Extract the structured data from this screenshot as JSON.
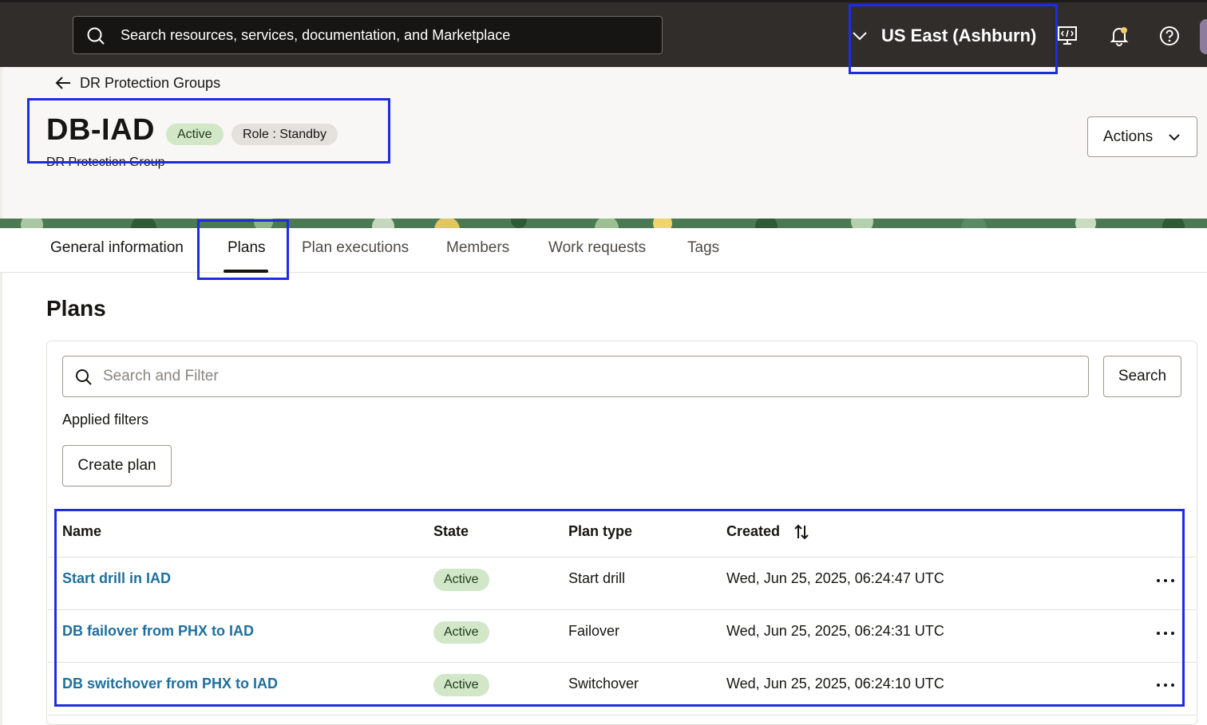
{
  "topbar": {
    "search_placeholder": "Search resources, services, documentation, and Marketplace",
    "region": "US East (Ashburn)",
    "icons": [
      "search-icon",
      "chevron-down-icon",
      "cloud-shell-icon",
      "bell-icon",
      "help-icon"
    ]
  },
  "header": {
    "breadcrumb": "DR Protection Groups",
    "title": "DB-IAD",
    "status_badge": "Active",
    "role_badge": "Role : Standby",
    "subtitle": "DR Protection Group",
    "actions_label": "Actions"
  },
  "tabs": [
    {
      "label": "General information"
    },
    {
      "label": "Plans",
      "selected": true
    },
    {
      "label": "Plan executions"
    },
    {
      "label": "Members"
    },
    {
      "label": "Work requests"
    },
    {
      "label": "Tags"
    }
  ],
  "plans": {
    "section_title": "Plans",
    "filter_placeholder": "Search and Filter",
    "search_label": "Search",
    "applied_filters_label": "Applied filters",
    "create_label": "Create plan",
    "columns": [
      "Name",
      "State",
      "Plan type",
      "Created"
    ],
    "rows": [
      {
        "name": "Start drill in IAD",
        "state": "Active",
        "type": "Start drill",
        "created": "Wed, Jun 25, 2025, 06:24:47 UTC"
      },
      {
        "name": "DB failover from PHX to IAD",
        "state": "Active",
        "type": "Failover",
        "created": "Wed, Jun 25, 2025, 06:24:31 UTC"
      },
      {
        "name": "DB switchover from PHX to IAD",
        "state": "Active",
        "type": "Switchover",
        "created": "Wed, Jun 25, 2025, 06:24:10 UTC"
      }
    ]
  },
  "colors": {
    "topbar": "#312d2a",
    "link": "#1e6f9e",
    "active_badge": "#d1e7c8",
    "highlight": "#1f2ce0"
  }
}
